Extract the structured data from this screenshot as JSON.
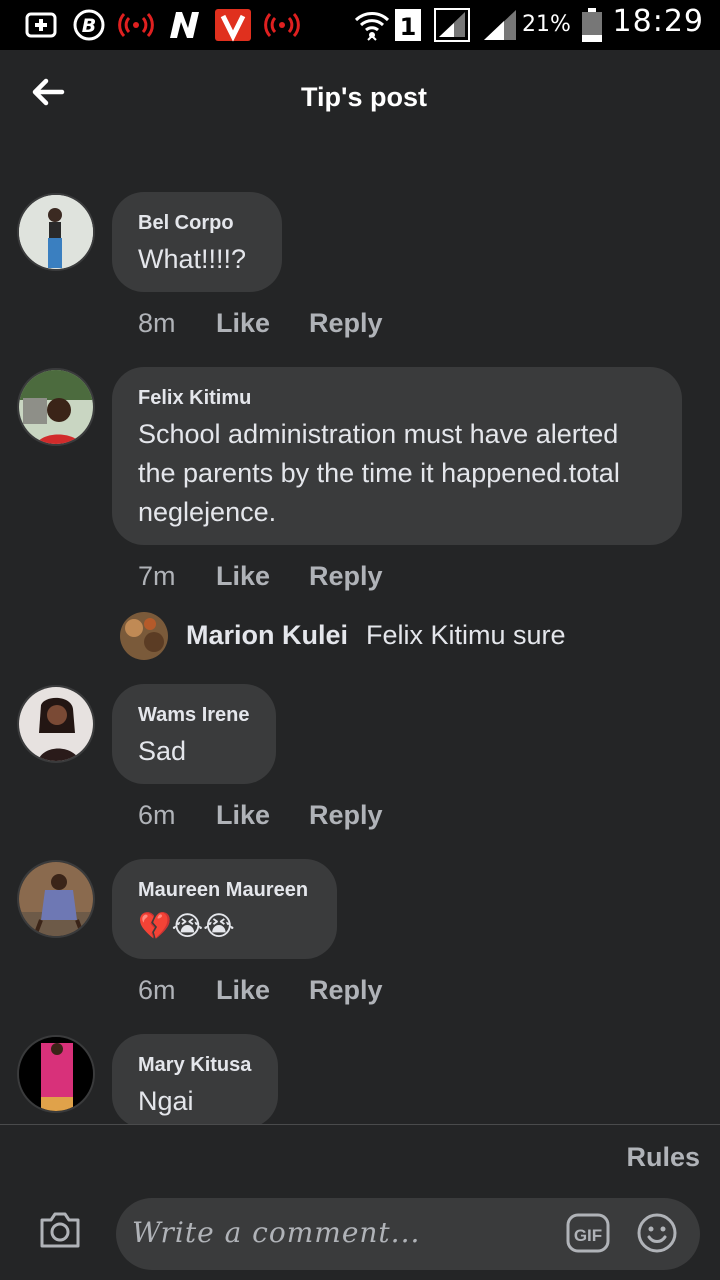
{
  "status_bar": {
    "battery_pct": "21%",
    "time": "18:29",
    "icons": [
      "plus-box-icon",
      "b-circle-icon",
      "broadcast-icon",
      "n-logo-icon",
      "v-logo-icon",
      "broadcast-icon",
      "wifi-icon",
      "sim-1-icon",
      "signal-icon",
      "signal-icon",
      "battery-icon"
    ]
  },
  "header": {
    "title": "Tip's post",
    "back_icon": "back-arrow-icon"
  },
  "comments": [
    {
      "author": "Bel Corpo",
      "text": "What!!!!?",
      "time": "8m",
      "like": "Like",
      "reply": "Reply"
    },
    {
      "author": "Felix Kitimu",
      "text": "School administration must have alerted the parents by the time it happened.total neglejence.",
      "time": "7m",
      "like": "Like",
      "reply": "Reply"
    },
    {
      "author": "Wams Irene",
      "text": "Sad",
      "time": "6m",
      "like": "Like",
      "reply": "Reply"
    },
    {
      "author": "Maureen Maureen",
      "text": "💔😭😭",
      "time": "6m",
      "like": "Like",
      "reply": "Reply"
    },
    {
      "author": "Mary Kitusa",
      "text": "Ngai"
    }
  ],
  "reply_preview": {
    "author": "Marion Kulei",
    "text": "Felix Kitimu sure"
  },
  "footer": {
    "rules_label": "Rules",
    "placeholder": "Write a comment...",
    "gif_label": "GIF"
  },
  "colors": {
    "background": "#242526",
    "bubble": "#3a3b3c",
    "text": "#e4e6eb",
    "muted": "#b0b3b8"
  }
}
